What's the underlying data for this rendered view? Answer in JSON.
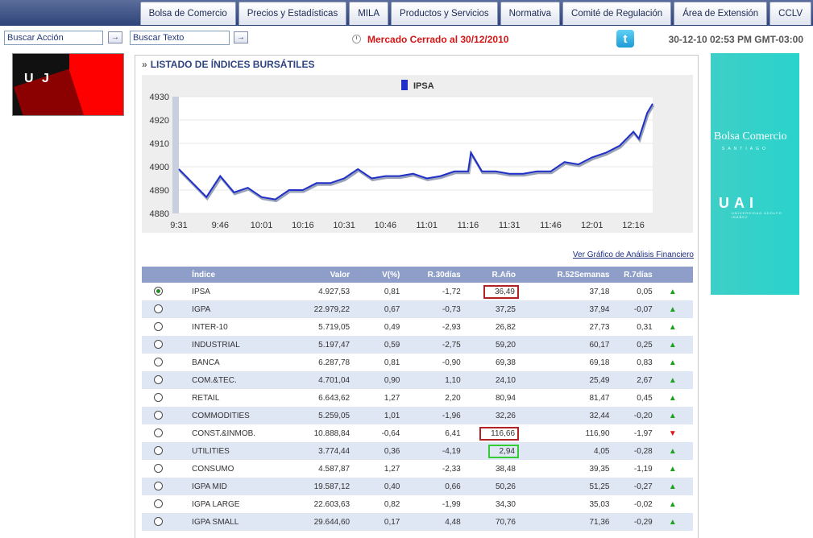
{
  "nav": [
    "Bolsa de Comercio",
    "Precios y Estadísticas",
    "MILA",
    "Productos y Servicios",
    "Normativa",
    "Comité de Regulación",
    "Área de Extensión",
    "CCLV"
  ],
  "search": {
    "action_placeholder": "Buscar Acción",
    "text_placeholder": "Buscar Texto",
    "go": "→"
  },
  "market_status": "Mercado Cerrado al 30/12/2010",
  "datetime": "30-12-10 02:53 PM GMT-03:00",
  "twitter": "t",
  "left_banner": {
    "letters": "U  J"
  },
  "right_banner": {
    "logo1": "Bolsa Comercio",
    "sub1": "SANTIAGO",
    "logo2": "UAI",
    "sub2": "UNIVERSIDAD ADOLFO IBÁÑEZ"
  },
  "panel": {
    "prefix": "»",
    "title": "LISTADO DE ÍNDICES BURSÁTILES",
    "link": "Ver Gráfico de Análisis Financiero"
  },
  "chart_data": {
    "type": "line",
    "series": [
      {
        "name": "IPSA",
        "color": "#1f2fc8"
      }
    ],
    "x": [
      "9:31",
      "9:36",
      "9:41",
      "9:46",
      "9:51",
      "9:56",
      "10:01",
      "10:06",
      "10:11",
      "10:16",
      "10:21",
      "10:26",
      "10:31",
      "10:36",
      "10:41",
      "10:46",
      "10:51",
      "10:56",
      "11:01",
      "11:06",
      "11:11",
      "11:16",
      "11:17",
      "11:21",
      "11:26",
      "11:31",
      "11:36",
      "11:41",
      "11:46",
      "11:51",
      "11:56",
      "12:01",
      "12:06",
      "12:11",
      "12:16",
      "12:18",
      "12:21",
      "12:23"
    ],
    "y": [
      4899,
      4893,
      4887,
      4896,
      4889,
      4891,
      4887,
      4886,
      4890,
      4890,
      4893,
      4893,
      4895,
      4899,
      4895,
      4896,
      4896,
      4897,
      4895,
      4896,
      4898,
      4898,
      4906,
      4898,
      4898,
      4897,
      4897,
      4898,
      4898,
      4902,
      4901,
      4904,
      4906,
      4909,
      4915,
      4912,
      4923,
      4927
    ],
    "x_ticks": [
      "9:31",
      "9:46",
      "10:01",
      "10:16",
      "10:31",
      "10:46",
      "11:01",
      "11:16",
      "11:31",
      "11:46",
      "12:01",
      "12:16"
    ],
    "y_ticks": [
      4880,
      4890,
      4900,
      4910,
      4920,
      4930
    ],
    "ylim": [
      4880,
      4930
    ],
    "legend": "top-center"
  },
  "table": {
    "headers": [
      "",
      "Índice",
      "Valor",
      "V(%)",
      "R.30días",
      "R.Año",
      "R.52Semanas",
      "R.7días",
      ""
    ],
    "rows": [
      {
        "name": "IPSA",
        "valor": "4.927,53",
        "v": "0,81",
        "r30": "-1,72",
        "ra": "36,49",
        "r52": "37,18",
        "r7": "0,05",
        "trend": "up",
        "selected": true,
        "box": "#b22222"
      },
      {
        "name": "IGPA",
        "valor": "22.979,22",
        "v": "0,67",
        "r30": "-0,73",
        "ra": "37,25",
        "r52": "37,94",
        "r7": "-0,07",
        "trend": "up"
      },
      {
        "name": "INTER-10",
        "valor": "5.719,05",
        "v": "0,49",
        "r30": "-2,93",
        "ra": "26,82",
        "r52": "27,73",
        "r7": "0,31",
        "trend": "up"
      },
      {
        "name": "INDUSTRIAL",
        "valor": "5.197,47",
        "v": "0,59",
        "r30": "-2,75",
        "ra": "59,20",
        "r52": "60,17",
        "r7": "0,25",
        "trend": "up"
      },
      {
        "name": "BANCA",
        "valor": "6.287,78",
        "v": "0,81",
        "r30": "-0,90",
        "ra": "69,38",
        "r52": "69,18",
        "r7": "0,83",
        "trend": "up"
      },
      {
        "name": "COM.&TEC.",
        "valor": "4.701,04",
        "v": "0,90",
        "r30": "1,10",
        "ra": "24,10",
        "r52": "25,49",
        "r7": "2,67",
        "trend": "up"
      },
      {
        "name": "RETAIL",
        "valor": "6.643,62",
        "v": "1,27",
        "r30": "2,20",
        "ra": "80,94",
        "r52": "81,47",
        "r7": "0,45",
        "trend": "up"
      },
      {
        "name": "COMMODITIES",
        "valor": "5.259,05",
        "v": "1,01",
        "r30": "-1,96",
        "ra": "32,26",
        "r52": "32,44",
        "r7": "-0,20",
        "trend": "up"
      },
      {
        "name": "CONST.&INMOB.",
        "valor": "10.888,84",
        "v": "-0,64",
        "r30": "6,41",
        "ra": "116,66",
        "r52": "116,90",
        "r7": "-1,97",
        "trend": "down",
        "box": "#b22222"
      },
      {
        "name": "UTILITIES",
        "valor": "3.774,44",
        "v": "0,36",
        "r30": "-4,19",
        "ra": "2,94",
        "r52": "4,05",
        "r7": "-0,28",
        "trend": "up",
        "box": "#33cc33"
      },
      {
        "name": "CONSUMO",
        "valor": "4.587,87",
        "v": "1,27",
        "r30": "-2,33",
        "ra": "38,48",
        "r52": "39,35",
        "r7": "-1,19",
        "trend": "up"
      },
      {
        "name": "IGPA MID",
        "valor": "19.587,12",
        "v": "0,40",
        "r30": "0,66",
        "ra": "50,26",
        "r52": "51,25",
        "r7": "-0,27",
        "trend": "up"
      },
      {
        "name": "IGPA LARGE",
        "valor": "22.603,63",
        "v": "0,82",
        "r30": "-1,99",
        "ra": "34,30",
        "r52": "35,03",
        "r7": "-0,02",
        "trend": "up"
      },
      {
        "name": "IGPA SMALL",
        "valor": "29.644,60",
        "v": "0,17",
        "r30": "4,48",
        "ra": "70,76",
        "r52": "71,36",
        "r7": "-0,29",
        "trend": "up"
      }
    ]
  }
}
